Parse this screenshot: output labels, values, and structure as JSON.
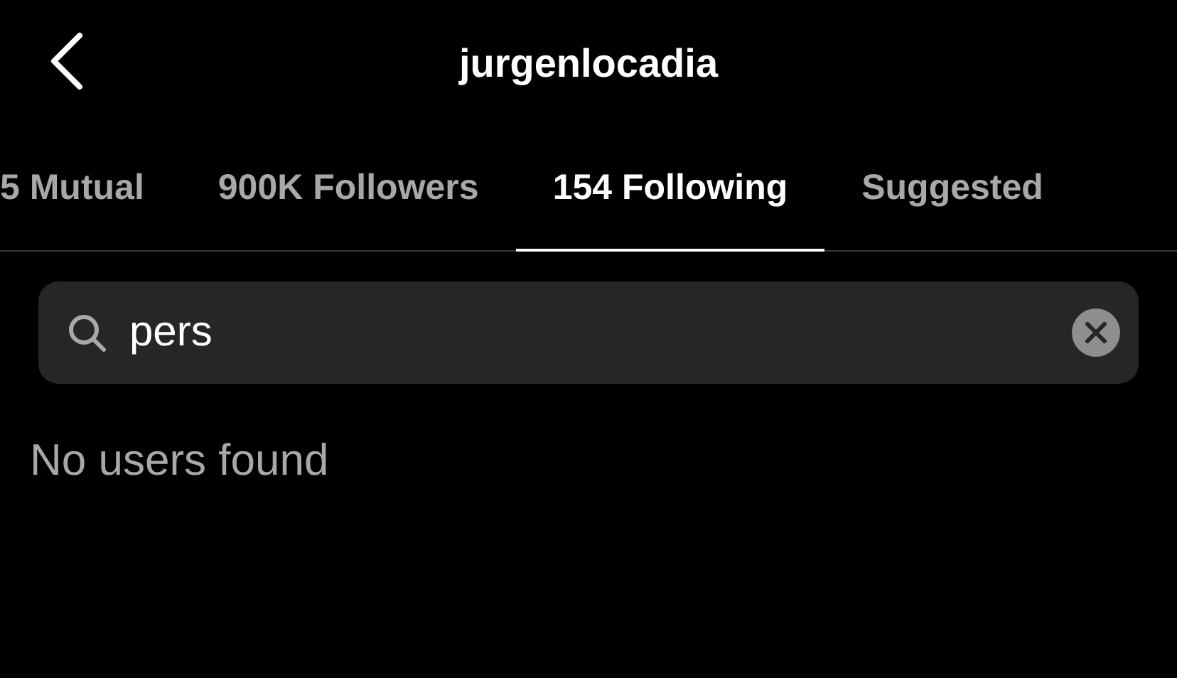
{
  "header": {
    "title": "jurgenlocadia"
  },
  "tabs": [
    {
      "label": "5 Mutual",
      "selected": false
    },
    {
      "label": "900K Followers",
      "selected": false
    },
    {
      "label": "154 Following",
      "selected": true
    },
    {
      "label": "Suggested",
      "selected": false
    }
  ],
  "search": {
    "value": "pers"
  },
  "empty_message": "No users found"
}
